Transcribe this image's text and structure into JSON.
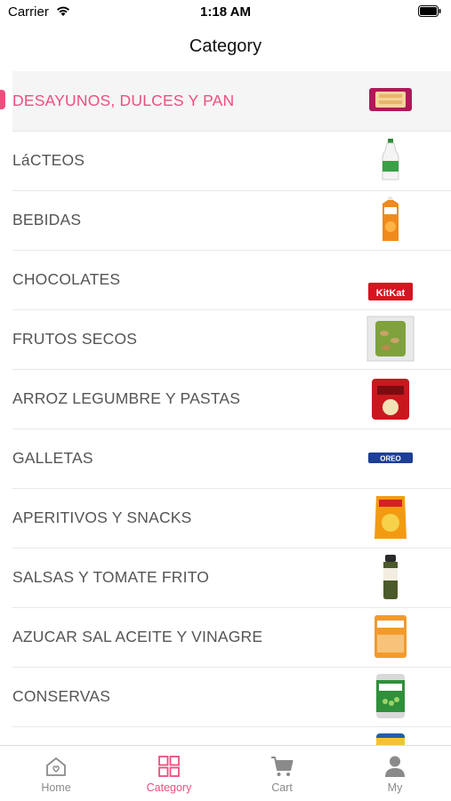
{
  "status_bar": {
    "carrier": "Carrier",
    "time": "1:18 AM"
  },
  "nav": {
    "title": "Category"
  },
  "categories": [
    {
      "label": "DESAYUNOS, DULCES Y PAN",
      "selected": true,
      "icon": "pastry-pack-icon"
    },
    {
      "label": "LáCTEOS",
      "selected": false,
      "icon": "milk-bottle-icon"
    },
    {
      "label": "BEBIDAS",
      "selected": false,
      "icon": "juice-carton-icon"
    },
    {
      "label": "CHOCOLATES",
      "selected": false,
      "icon": "chocolate-bar-icon"
    },
    {
      "label": "FRUTOS SECOS",
      "selected": false,
      "icon": "nuts-bag-icon"
    },
    {
      "label": "ARROZ LEGUMBRE Y PASTAS",
      "selected": false,
      "icon": "rice-pack-icon"
    },
    {
      "label": "GALLETAS",
      "selected": false,
      "icon": "cookie-pack-icon"
    },
    {
      "label": "APERITIVOS Y SNACKS",
      "selected": false,
      "icon": "chips-bag-icon"
    },
    {
      "label": "SALSAS Y TOMATE FRITO",
      "selected": false,
      "icon": "sauce-bottle-icon"
    },
    {
      "label": "AZUCAR SAL ACEITE Y VINAGRE",
      "selected": false,
      "icon": "sugar-bag-icon"
    },
    {
      "label": "CONSERVAS",
      "selected": false,
      "icon": "peas-can-icon"
    },
    {
      "label": "",
      "selected": false,
      "icon": "can-icon"
    }
  ],
  "tabs": [
    {
      "label": "Home",
      "icon": "home-icon",
      "active": false
    },
    {
      "label": "Category",
      "icon": "grid-icon",
      "active": true
    },
    {
      "label": "Cart",
      "icon": "cart-icon",
      "active": false
    },
    {
      "label": "My",
      "icon": "user-icon",
      "active": false
    }
  ],
  "colors": {
    "accent": "#ec4f7e",
    "text": "#555555",
    "tab_inactive": "#8a8a8a",
    "selected_bg": "#f5f5f5"
  }
}
